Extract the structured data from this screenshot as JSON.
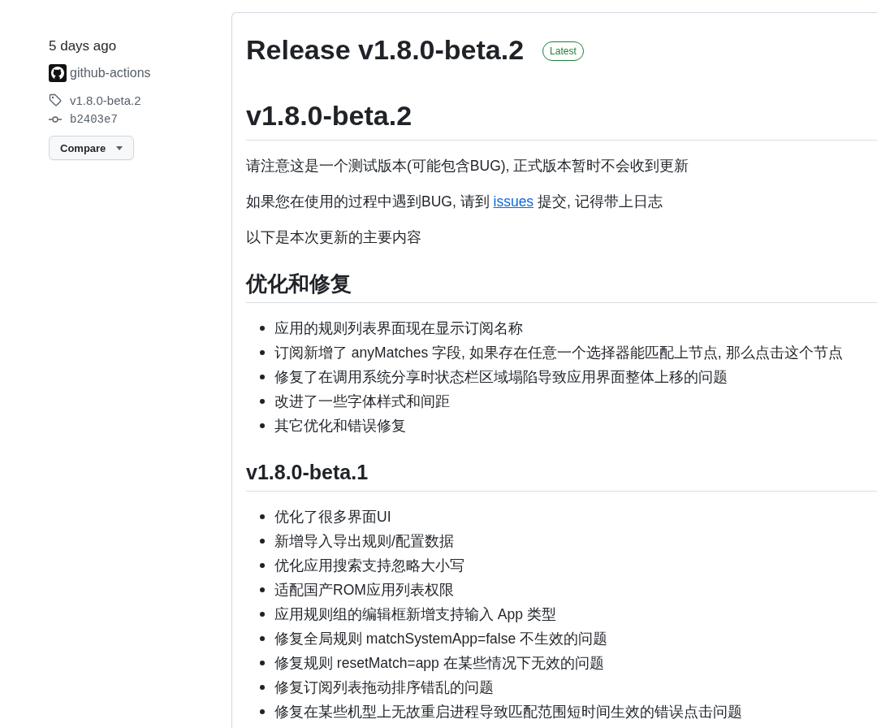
{
  "sidebar": {
    "time": "5 days ago",
    "author": "github-actions",
    "tag": "v1.8.0-beta.2",
    "commit": "b2403e7",
    "compare_button": "Compare"
  },
  "release": {
    "title": "Release v1.8.0-beta.2",
    "badge": "Latest",
    "body": [
      {
        "kind": "h1",
        "text": "v1.8.0-beta.2"
      },
      {
        "kind": "paragraph",
        "segments": [
          {
            "kind": "text",
            "text": "请注意这是一个测试版本(可能包含BUG), 正式版本暂时不会收到更新"
          }
        ]
      },
      {
        "kind": "paragraph",
        "segments": [
          {
            "kind": "text",
            "text": "如果您在使用的过程中遇到BUG, 请到 "
          },
          {
            "kind": "link",
            "text": "issues"
          },
          {
            "kind": "text",
            "text": " 提交, 记得带上日志"
          }
        ]
      },
      {
        "kind": "paragraph",
        "segments": [
          {
            "kind": "text",
            "text": "以下是本次更新的主要内容"
          }
        ]
      },
      {
        "kind": "h2",
        "text": "优化和修复"
      },
      {
        "kind": "list",
        "items": [
          "应用的规则列表界面现在显示订阅名称",
          "订阅新增了 anyMatches 字段, 如果存在任意一个选择器能匹配上节点, 那么点击这个节点",
          "修复了在调用系统分享时状态栏区域塌陷导致应用界面整体上移的问题",
          "改进了一些字体样式和间距",
          "其它优化和错误修复"
        ]
      },
      {
        "kind": "h3",
        "text": "v1.8.0-beta.1"
      },
      {
        "kind": "list",
        "items": [
          "优化了很多界面UI",
          "新增导入导出规则/配置数据",
          "优化应用搜索支持忽略大小写",
          "适配国产ROM应用列表权限",
          "应用规则组的编辑框新增支持输入 App 类型",
          "修复全局规则 matchSystemApp=false 不生效的问题",
          "修复规则 resetMatch=app 在某些情况下无效的问题",
          "修复订阅列表拖动排序错乱的问题",
          "修复在某些机型上无故重启进程导致匹配范围短时间生效的错误点击问题"
        ]
      }
    ]
  }
}
